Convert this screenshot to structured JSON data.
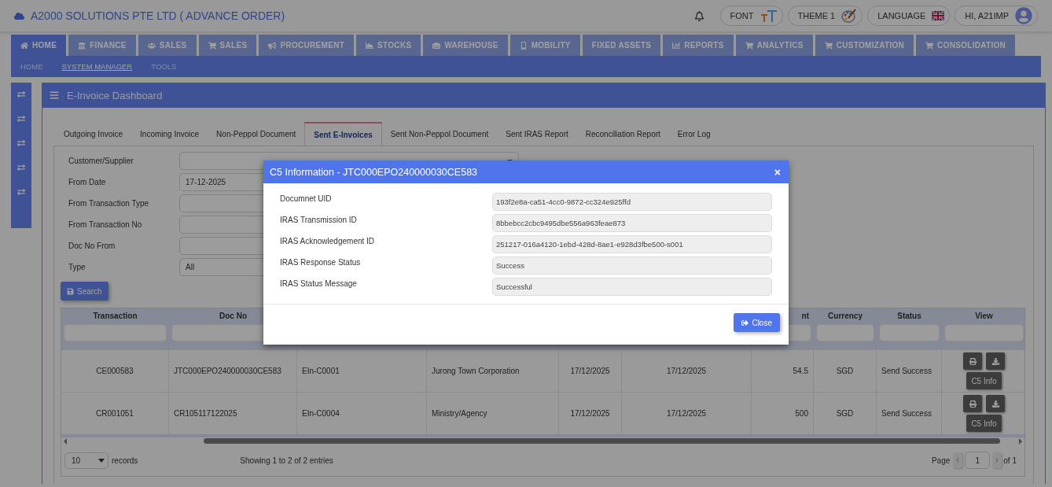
{
  "header": {
    "title": "A2000 SOLUTIONS PTE LTD ( ADVANCE ORDER)",
    "buttons": [
      {
        "kind": "font",
        "label": "FONT"
      },
      {
        "kind": "theme",
        "label": "THEME 1"
      },
      {
        "kind": "language",
        "label": "LANGUAGE"
      },
      {
        "kind": "user",
        "label": "HI, A21IMP"
      }
    ]
  },
  "modules": [
    {
      "kind": "home",
      "label": "HOME",
      "selected": true
    },
    {
      "kind": "bank",
      "label": "FINANCE",
      "selected": false
    },
    {
      "kind": "users",
      "label": "SALES",
      "selected": false
    },
    {
      "kind": "cart",
      "label": "SALES",
      "selected": false
    },
    {
      "kind": "bullhorn",
      "label": "PROCUREMENT",
      "selected": false
    },
    {
      "kind": "area",
      "label": "STOCKS",
      "selected": false
    },
    {
      "kind": "warehouse",
      "label": "WAREHOUSE",
      "selected": false
    },
    {
      "kind": "mobile",
      "label": "MOBILITY",
      "selected": false
    },
    {
      "kind": "blank",
      "label": "FIXED ASSETS",
      "selected": false
    },
    {
      "kind": "bars",
      "label": "REPORTS",
      "selected": false
    },
    {
      "kind": "cart",
      "label": "ANALYTICS",
      "selected": false
    },
    {
      "kind": "cart",
      "label": "CUSTOMIZATION",
      "selected": false
    },
    {
      "kind": "cart",
      "label": "CONSOLIDATION",
      "selected": false
    }
  ],
  "submenu": [
    {
      "label": "HOME",
      "selected": false
    },
    {
      "label": "SYSTEM MANAGER",
      "selected": true
    },
    {
      "label": "TOOLS",
      "selected": false
    }
  ],
  "rail": [
    {
      "kind": "exchange"
    },
    {
      "kind": "exchange"
    },
    {
      "kind": "exchange"
    },
    {
      "kind": "exchange"
    },
    {
      "kind": "exchange"
    }
  ],
  "dashboard": {
    "title": "E-Invoice Dashboard",
    "tabs": [
      {
        "label": "Outgoing Invoice",
        "selected": false
      },
      {
        "label": "Incoming Invoice",
        "selected": false
      },
      {
        "label": "Non-Peppol Document",
        "selected": false
      },
      {
        "label": "Sent E-Invoices",
        "selected": true
      },
      {
        "label": "Sent Non-Peppol Document",
        "selected": false
      },
      {
        "label": "Sent IRAS Report",
        "selected": false
      },
      {
        "label": "Reconciliation Report",
        "selected": false
      },
      {
        "label": "Error Log",
        "selected": false
      }
    ],
    "filters": [
      {
        "kind": "select",
        "label": "Customer/Supplier"
      },
      {
        "kind": "input",
        "label": "From Date",
        "value": "17-12-2025"
      },
      {
        "kind": "input",
        "label": "From Transaction Type"
      },
      {
        "kind": "input",
        "label": "From Transaction No"
      },
      {
        "kind": "input",
        "label": "Doc No From"
      },
      {
        "kind": "input",
        "label": "Type",
        "value": "All"
      }
    ],
    "search_button": "Search",
    "table": {
      "columns": [
        "Transaction",
        "Doc No",
        null,
        null,
        null,
        null,
        "nt",
        "Currency",
        "Status",
        "View"
      ],
      "rows": [
        {
          "cells": [
            "CE000583",
            "JTC000EPO240000030CE583",
            "EIn-C0001",
            "Jurong Town Corporation",
            "17/12/2025",
            "17/12/2025",
            "54.5",
            "SGD",
            "Send Success"
          ],
          "action": "C5 Info"
        },
        {
          "cells": [
            "CR001051",
            "CR105117122025",
            "EIn-C0004",
            "Ministry/Agency",
            "17/12/2025",
            "17/12/2025",
            "500",
            "SGD",
            "Send Success"
          ],
          "action": "C5 Info"
        }
      ]
    },
    "footer": {
      "page_size": "10",
      "records_label": "records",
      "info": "Showing 1 to 2 of 2 entries",
      "page_label": "Page",
      "page": "1",
      "page_total": "of 1"
    }
  },
  "modal": {
    "title": "C5 Information - JTC000EPO240000030CE583",
    "close_icon": "×",
    "fields": [
      {
        "label": "Documnet UID",
        "value": "193f2e8a-ca51-4cc0-9872-cc324e925ffd"
      },
      {
        "label": "IRAS Transmission ID",
        "value": "8bbebcc2cbc9495dbe556a963feae873"
      },
      {
        "label": "IRAS Acknowledgement ID",
        "value": "251217-016a4120-1ebd-428d-8ae1-e928d3fbe500-s001"
      },
      {
        "label": "IRAS Response Status",
        "value": "Success"
      },
      {
        "label": "IRAS Status Message",
        "value": "Successful"
      }
    ],
    "close_button": "Close"
  }
}
